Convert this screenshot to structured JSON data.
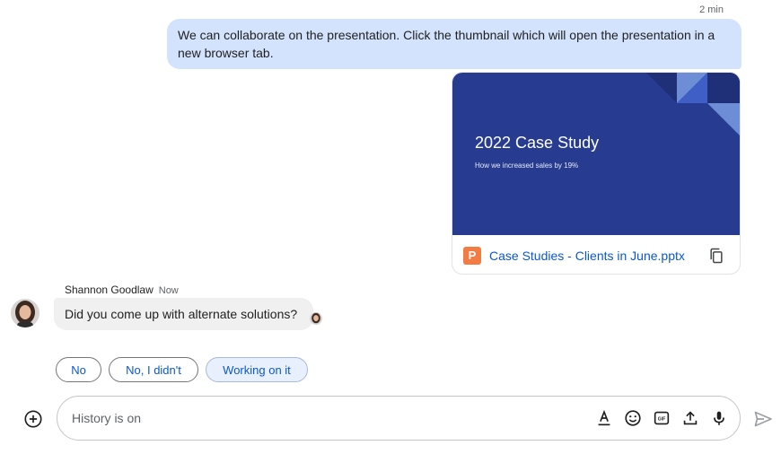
{
  "outgoing": {
    "timestamp": "2 min",
    "text": "We can collaborate on the presentation. Click the thumbnail which will open the presentation in a new browser tab."
  },
  "attachment": {
    "slide_title": "2022 Case Study",
    "slide_subtitle": "How we increased sales by 19%",
    "file_type_letter": "P",
    "file_name": "Case Studies - Clients in June.pptx",
    "copy_icon": "copy-icon"
  },
  "incoming": {
    "sender": "Shannon Goodlaw",
    "time": "Now",
    "text": "Did you come up with alternate solutions?"
  },
  "smart_replies": [
    "No",
    "No, I didn't",
    "Working on it"
  ],
  "composer": {
    "placeholder": "History is on",
    "tools": [
      "format-text-icon",
      "emoji-icon",
      "gif-icon",
      "upload-icon",
      "microphone-icon"
    ],
    "send_icon": "send-icon",
    "add_icon": "add-circle-icon"
  },
  "colors": {
    "outgoing_bubble": "#d3e3fd",
    "incoming_bubble": "#f0f0f0",
    "slide_background": "#273c91",
    "link_blue": "#0b57d0",
    "powerpoint_orange": "#f37c45"
  }
}
